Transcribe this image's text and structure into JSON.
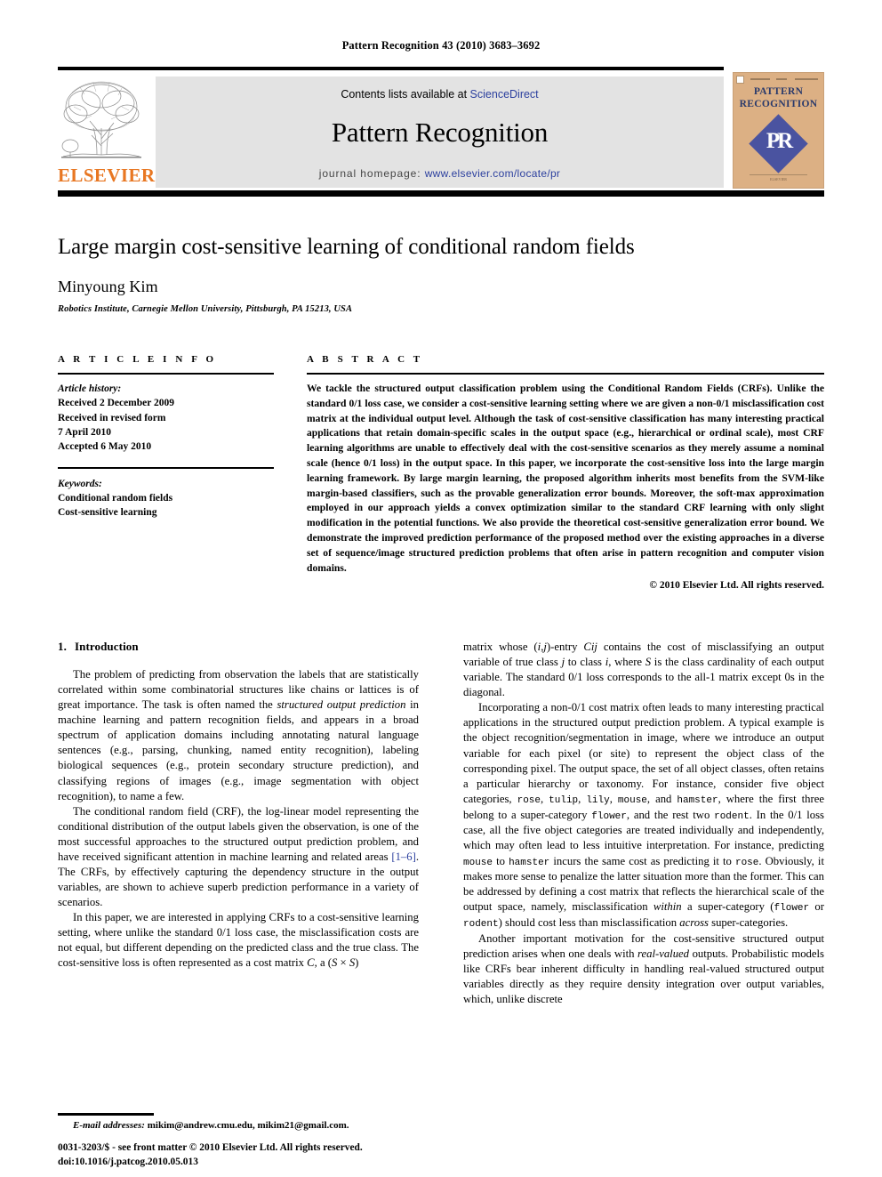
{
  "running_head": "Pattern Recognition 43 (2010) 3683–3692",
  "masthead": {
    "contents_prefix": "Contents lists available at ",
    "sciencedirect": "ScienceDirect",
    "journal_name": "Pattern Recognition",
    "homepage_prefix": "journal homepage: ",
    "homepage_url": "www.elsevier.com/locate/pr",
    "publisher_wordmark": "ELSEVIER",
    "cover_title_line1": "PATTERN",
    "cover_title_line2": "RECOGNITION",
    "cover_monogram": "PR",
    "accent_orange": "#E87722",
    "link_blue": "#2b3f9e",
    "cover_tan": "#dcb084",
    "cover_blue": "#4a53a0"
  },
  "title_block": {
    "title": "Large margin cost-sensitive learning of conditional random fields",
    "author": "Minyoung Kim",
    "affiliation": "Robotics Institute, Carnegie Mellon University, Pittsburgh, PA 15213, USA"
  },
  "article_info": {
    "heading": "A R T I C L E   I N F O",
    "history_label": "Article history:",
    "history": [
      "Received 2 December 2009",
      "Received in revised form",
      "7 April 2010",
      "Accepted 6 May 2010"
    ],
    "keywords_label": "Keywords:",
    "keywords": [
      "Conditional random fields",
      "Cost-sensitive learning"
    ]
  },
  "abstract": {
    "heading": "A B S T R A C T",
    "text": "We tackle the structured output classification problem using the Conditional Random Fields (CRFs). Unlike the standard 0/1 loss case, we consider a cost-sensitive learning setting where we are given a non-0/1 misclassification cost matrix at the individual output level. Although the task of cost-sensitive classification has many interesting practical applications that retain domain-specific scales in the output space (e.g., hierarchical or ordinal scale), most CRF learning algorithms are unable to effectively deal with the cost-sensitive scenarios as they merely assume a nominal scale (hence 0/1 loss) in the output space. In this paper, we incorporate the cost-sensitive loss into the large margin learning framework. By large margin learning, the proposed algorithm inherits most benefits from the SVM-like margin-based classifiers, such as the provable generalization error bounds. Moreover, the soft-max approximation employed in our approach yields a convex optimization similar to the standard CRF learning with only slight modification in the potential functions. We also provide the theoretical cost-sensitive generalization error bound. We demonstrate the improved prediction performance of the proposed method over the existing approaches in a diverse set of sequence/image structured prediction problems that often arise in pattern recognition and computer vision domains.",
    "copyright": "© 2010 Elsevier Ltd. All rights reserved."
  },
  "introduction": {
    "number": "1.",
    "title": "Introduction",
    "p1_a": "The problem of predicting from observation the labels that are statistically correlated within some combinatorial structures like chains or lattices is of great importance. The task is often named the ",
    "p1_italic": "structured output prediction",
    "p1_b": " in machine learning and pattern recognition fields, and appears in a broad spectrum of application domains including annotating natural language sentences (e.g., parsing, chunking, named entity recognition), labeling biological sequences (e.g., protein secondary structure prediction), and classifying regions of images (e.g., image segmentation with object recognition), to name a few.",
    "p2_a": "The conditional random field (CRF), the log-linear model representing the conditional distribution of the output labels given the observation, is one of the most successful approaches to the structured output prediction problem, and have received significant attention in machine learning and related areas ",
    "p2_cite": "[1–6]",
    "p2_b": ". The CRFs, by effectively capturing the dependency structure in the output variables, are shown to achieve superb prediction performance in a variety of scenarios.",
    "p3_a": "In this paper, we are interested in applying CRFs to a cost-sensitive learning setting, where unlike the standard 0/1 loss case, the misclassification costs are not equal, but different depending on the predicted class and the true class. The cost-sensitive loss is often represented as a cost matrix ",
    "p3_c": "C",
    "p3_b": ", a (",
    "p3_s1": "S",
    "p3_x": " × ",
    "p3_s2": "S",
    "p3_d": ")",
    "p4_a": "matrix whose (",
    "p4_i": "i",
    "p4_comma": ",",
    "p4_j": "j",
    "p4_b": ")-entry ",
    "p4_cij": "Cij",
    "p4_c": " contains the cost of misclassifying an output variable of true class ",
    "p4_j2": "j",
    "p4_d": " to class ",
    "p4_i2": "i",
    "p4_e": ", where ",
    "p4_s": "S",
    "p4_f": " is the class cardinality of each output variable. The standard 0/1 loss corresponds to the all-1 matrix except 0s in the diagonal.",
    "p5_a": "Incorporating a non-0/1 cost matrix often leads to many interesting practical applications in the structured output prediction problem. A typical example is the object recognition/segmentation in image, where we introduce an output variable for each pixel (or site) to represent the object class of the corresponding pixel. The output space, the set of all object classes, often retains a particular hierarchy or taxonomy. For instance, consider five object categories, ",
    "cat_rose": "rose",
    "cat_tulip": "tulip",
    "cat_lily": "lily",
    "cat_mouse": "mouse",
    "cat_hamster": "hamster",
    "cat_flower": "flower",
    "cat_rodent": "rodent",
    "p5_b": ", ",
    "p5_c": ", and ",
    "p5_d": ", where the first three belong to a super-category ",
    "p5_e": ", and the rest two ",
    "p5_f": ". In the 0/1 loss case, all the five object categories are treated individually and independently, which may often lead to less intuitive interpretation. For instance, predicting ",
    "p5_g": " to ",
    "p5_h": " incurs the same cost as predicting it to ",
    "p5_i": ". Obviously, it makes more sense to penalize the latter situation more than the former. This can be addressed by defining a cost matrix that reflects the hierarchical scale of the output space, namely, misclassification ",
    "p5_within": "within",
    "p5_j": " a super-category (",
    "p5_or": " or ",
    "p5_k": ") should cost less than misclassification ",
    "p5_across": "across",
    "p5_l": " super-categories.",
    "p6_a": "Another important motivation for the cost-sensitive structured output prediction arises when one deals with ",
    "p6_rv": "real-valued",
    "p6_b": " outputs. Probabilistic models like CRFs bear inherent difficulty in handling real-valued structured output variables directly as they require density integration over output variables, which, unlike discrete"
  },
  "footnote": {
    "email_label": "E-mail addresses:",
    "emails": "mikim@andrew.cmu.edu, mikim21@gmail.com.",
    "issn_line": "0031-3203/$ - see front matter © 2010 Elsevier Ltd. All rights reserved.",
    "doi_line": "doi:10.1016/j.patcog.2010.05.013"
  }
}
